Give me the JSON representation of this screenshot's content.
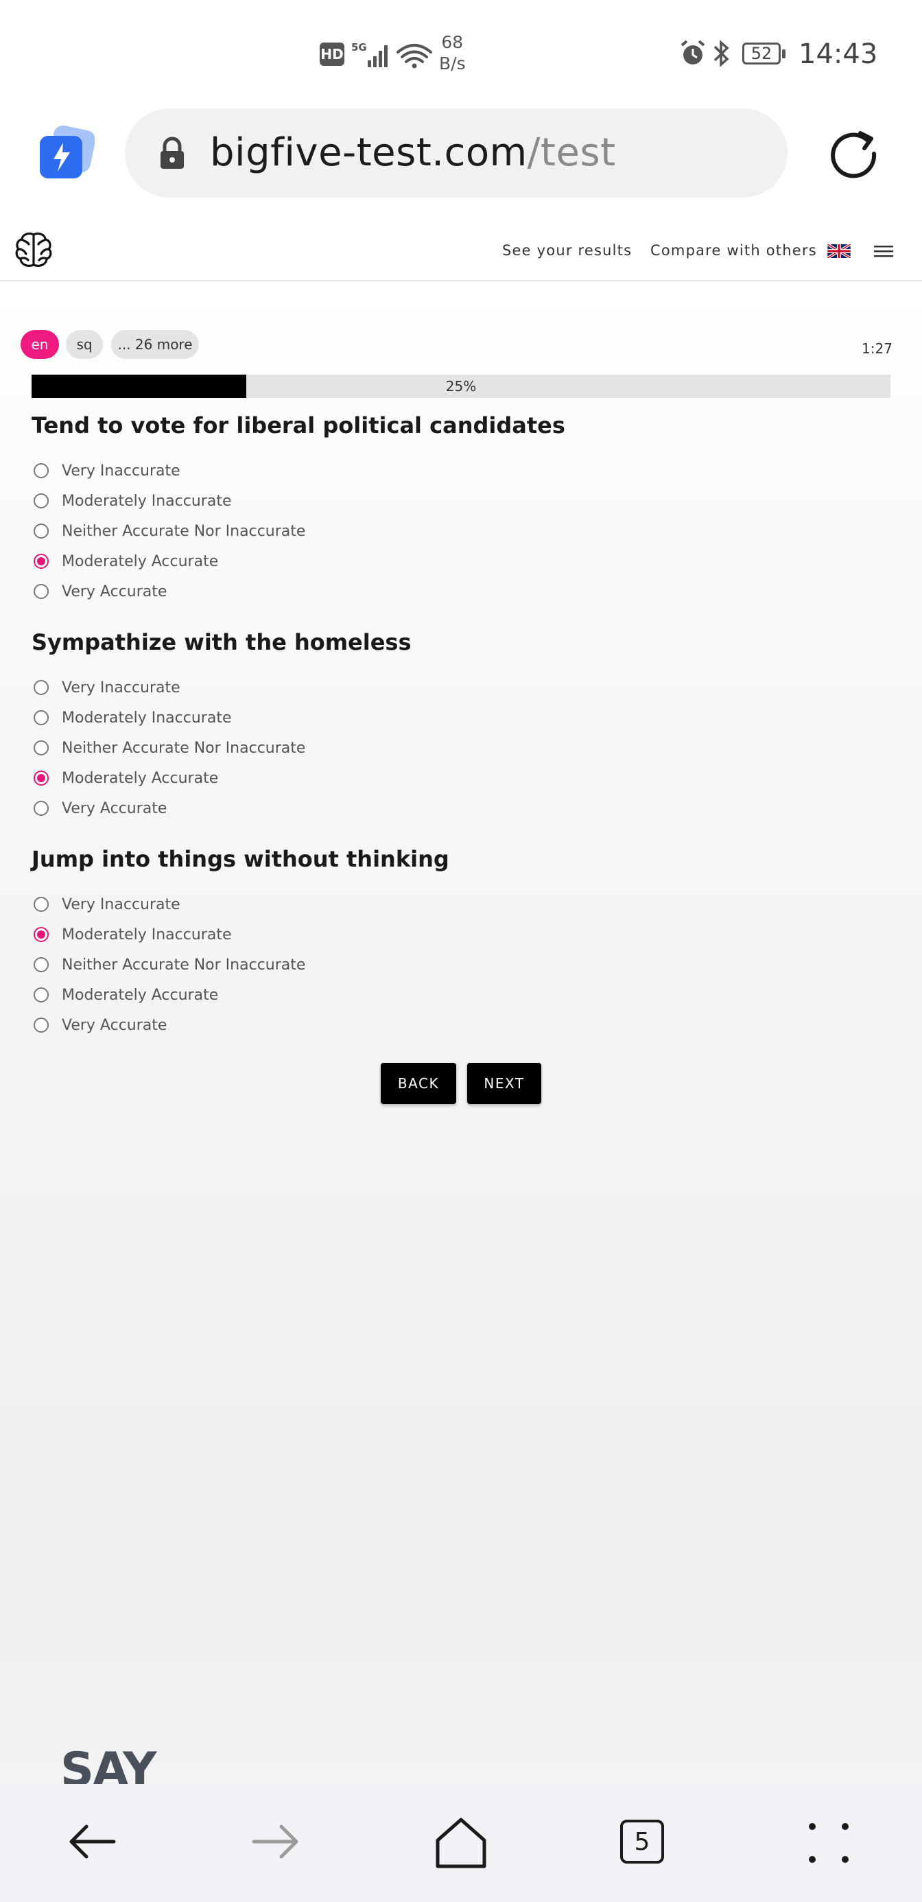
{
  "status_bar": {
    "hd_badge": "HD",
    "network": "5G",
    "speed_value": "68",
    "speed_unit": "B/s",
    "battery": "52",
    "time": "14:43"
  },
  "browser": {
    "url_domain": "bigfive-test.com",
    "url_path": "/test",
    "tab_count": "5"
  },
  "nav": {
    "see_results": "See your results",
    "compare": "Compare with others"
  },
  "languages": {
    "chips": [
      "en",
      "sq",
      "... 26 more"
    ],
    "active": "en"
  },
  "timer": "1:27",
  "progress": {
    "percent": 25,
    "label": "25%"
  },
  "options": [
    "Very Inaccurate",
    "Moderately Inaccurate",
    "Neither Accurate Nor Inaccurate",
    "Moderately Accurate",
    "Very Accurate"
  ],
  "questions": [
    {
      "title": "Tend to vote for liberal political candidates",
      "selected": "Moderately Accurate"
    },
    {
      "title": "Sympathize with the homeless",
      "selected": "Moderately Accurate"
    },
    {
      "title": "Jump into things without thinking",
      "selected": "Moderately Inaccurate"
    }
  ],
  "buttons": {
    "back": "BACK",
    "next": "NEXT"
  },
  "ad": {
    "text": "SAY"
  },
  "colors": {
    "accent": "#e4177b",
    "chip_active": "#ee1a80",
    "button": "#000000",
    "progress_fill": "#000000"
  }
}
